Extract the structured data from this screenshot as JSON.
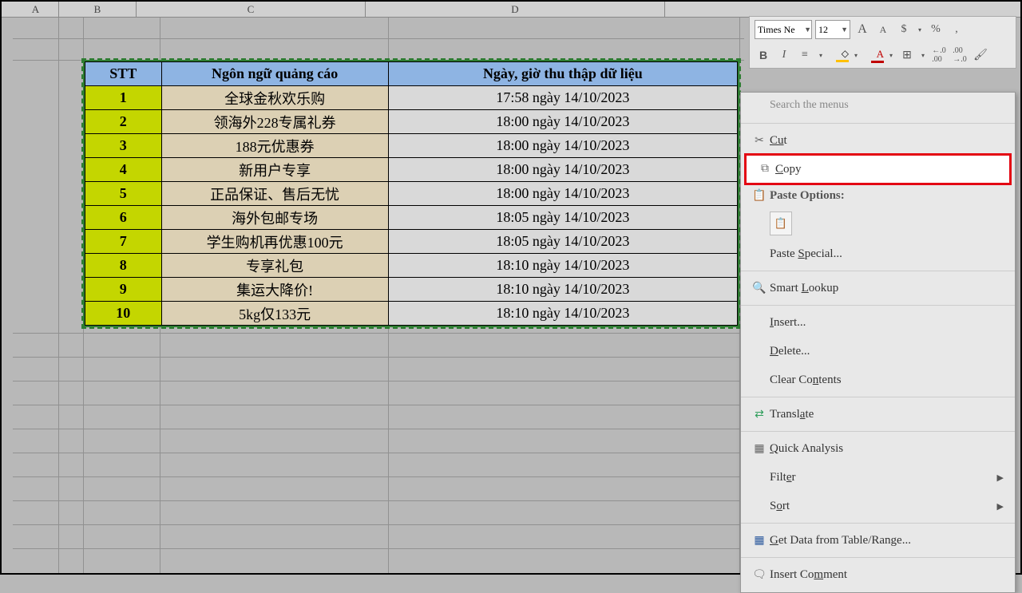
{
  "columns": [
    "A",
    "B",
    "C",
    "D"
  ],
  "headers": {
    "stt": "STT",
    "lang": "Ngôn ngữ quảng cáo",
    "date": "Ngày, giờ thu thập dữ liệu"
  },
  "rows": [
    {
      "n": "1",
      "c": "全球金秋欢乐购",
      "d": "17:58 ngày 14/10/2023"
    },
    {
      "n": "2",
      "c": "领海外228专属礼券",
      "d": "18:00 ngày 14/10/2023"
    },
    {
      "n": "3",
      "c": "188元优惠券",
      "d": "18:00 ngày 14/10/2023"
    },
    {
      "n": "4",
      "c": "新用户专享",
      "d": "18:00 ngày 14/10/2023"
    },
    {
      "n": "5",
      "c": "正品保证、售后无忧",
      "d": "18:00 ngày 14/10/2023"
    },
    {
      "n": "6",
      "c": "海外包邮专场",
      "d": "18:05 ngày 14/10/2023"
    },
    {
      "n": "7",
      "c": "学生购机再优惠100元",
      "d": "18:05 ngày 14/10/2023"
    },
    {
      "n": "8",
      "c": "专享礼包",
      "d": "18:10 ngày 14/10/2023"
    },
    {
      "n": "9",
      "c": "集运大降价!",
      "d": "18:10 ngày 14/10/2023"
    },
    {
      "n": "10",
      "c": "5kg仅133元",
      "d": "18:10 ngày 14/10/2023"
    }
  ],
  "toolbar": {
    "font": "Times Ne",
    "size": "12",
    "A_large": "A",
    "A_small": "A",
    "dollar": "$",
    "percent": "%",
    "comma": ",",
    "bold": "B",
    "italic": "I",
    "fontA": "A",
    "inc": ".0",
    "dec": ".00",
    "dec2": ".0"
  },
  "menu": {
    "search": "Search the menus",
    "cut": "Cut",
    "copy": "Copy",
    "paste": "Paste Options:",
    "pasteSpecial": "Paste Special...",
    "smart": "Smart Lookup",
    "insert": "Insert...",
    "delete": "Delete...",
    "clear": "Clear Contents",
    "translate": "Translate",
    "quick": "Quick Analysis",
    "filter": "Filter",
    "sort": "Sort",
    "getData": "Get Data from Table/Range...",
    "comment": "Insert Comment"
  }
}
